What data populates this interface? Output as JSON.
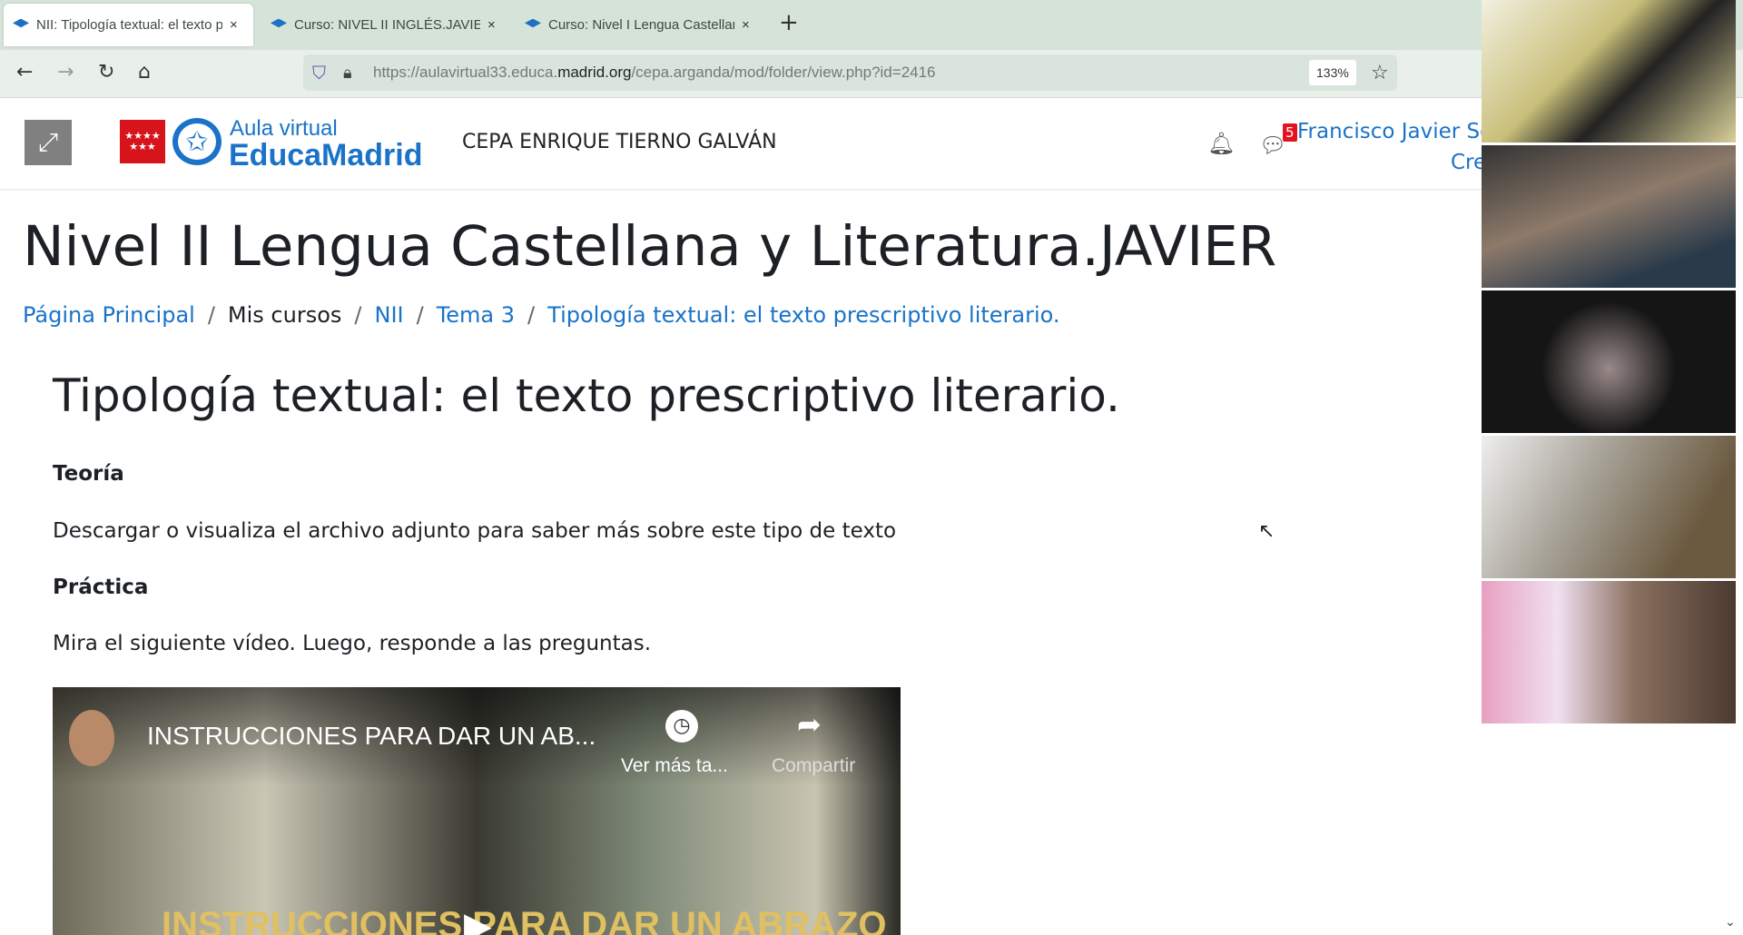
{
  "browser": {
    "tabs": [
      {
        "title": "NII: Tipología textual: el texto prescriptivo",
        "active": true
      },
      {
        "title": "Curso: NIVEL II INGLÉS.JAVIER",
        "active": false
      },
      {
        "title": "Curso: Nivel I Lengua Castellana",
        "active": false
      }
    ],
    "close_glyph": "×",
    "new_tab_glyph": "+",
    "url_prefix": "https://aulavirtual33.educa.",
    "url_domain": "madrid.org",
    "url_suffix": "/cepa.arganda/mod/folder/view.php?id=2416",
    "zoom": "133%"
  },
  "header": {
    "aula": "Aula virtual",
    "brand": "EducaMadrid",
    "flag_stars": "★★★★ ★★★",
    "school": "CEPA ENRIQUE TIERNO GALVÁN",
    "message_count": "5",
    "user_name": "Francisco Javier Se",
    "user_line2": "Cre"
  },
  "page": {
    "course_title": "Nivel II Lengua Castellana y Literatura.JAVIER",
    "breadcrumb": [
      "Página Principal",
      "Mis cursos",
      "NII",
      "Tema 3",
      "Tipología textual: el texto prescriptivo literario."
    ],
    "heading": "Tipología textual: el texto prescriptivo literario.",
    "theory_title": "Teoría",
    "theory_text": "Descargar o visualiza el archivo adjunto para saber más sobre este tipo de texto",
    "practice_title": "Práctica",
    "practice_text": "Mira el siguiente vídeo. Luego, responde a las preguntas."
  },
  "video": {
    "title": "INSTRUCCIONES PARA DAR UN AB...",
    "watch_later": "Ver más ta...",
    "share": "Compartir",
    "caption": "INSTRUCCIONES PARA DAR UN ABRAZO"
  },
  "participants": 5
}
